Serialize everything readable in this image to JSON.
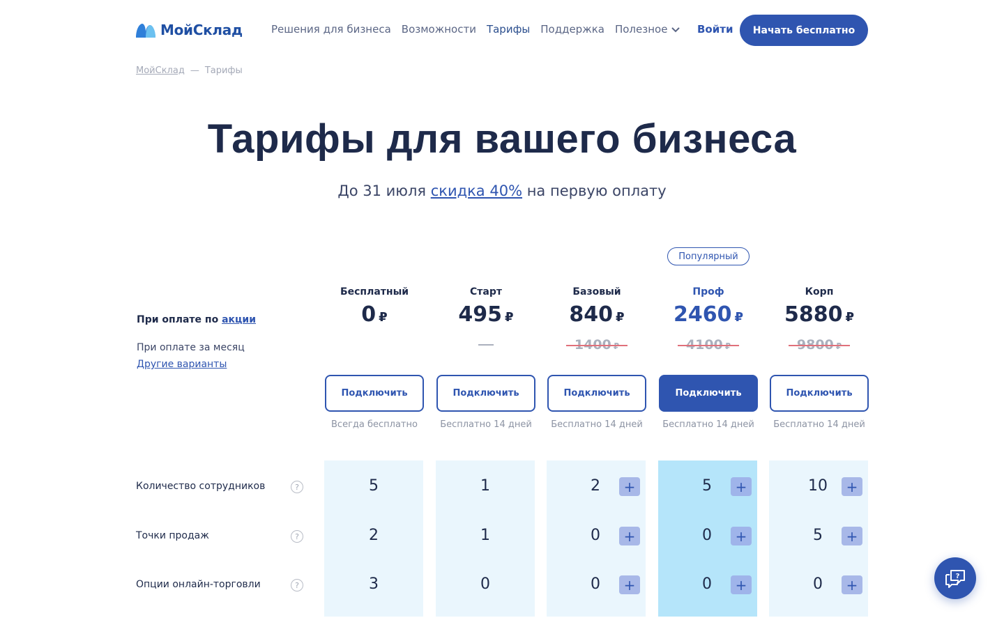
{
  "header": {
    "logo_text": "МойСклад",
    "nav": [
      "Решения для бизнеса",
      "Возможности",
      "Тарифы",
      "Поддержка",
      "Полезное"
    ],
    "login": "Войти",
    "cta": "Начать бесплатно"
  },
  "breadcrumb": {
    "home": "МойСклад",
    "sep": "—",
    "current": "Тарифы"
  },
  "hero": {
    "title": "Тарифы для вашего бизнеса",
    "sub_before": "До 31 июля ",
    "sub_link": "скидка 40%",
    "sub_after": " на первую оплату"
  },
  "labels": {
    "promo_prefix": "При оплате по ",
    "promo_link": "акции",
    "month": "При оплате за месяц",
    "other": "Другие варианты",
    "popular": "Популярный",
    "currency": "₽"
  },
  "plans": [
    {
      "name": "Бесплатный",
      "price": "0",
      "old": "",
      "dash": false,
      "button": "Подключить",
      "trial": "Всегда бесплатно"
    },
    {
      "name": "Старт",
      "price": "495",
      "old": "",
      "dash": true,
      "button": "Подключить",
      "trial": "Бесплатно 14 дней"
    },
    {
      "name": "Базовый",
      "price": "840",
      "old": "1400",
      "dash": false,
      "button": "Подключить",
      "trial": "Бесплатно 14 дней"
    },
    {
      "name": "Проф",
      "price": "2460",
      "old": "4100",
      "dash": false,
      "button": "Подключить",
      "trial": "Бесплатно 14 дней"
    },
    {
      "name": "Корп",
      "price": "5880",
      "old": "9800",
      "dash": false,
      "button": "Подключить",
      "trial": "Бесплатно 14 дней"
    }
  ],
  "features": [
    {
      "label": "Количество сотрудников",
      "values": [
        "5",
        "1",
        "2",
        "5",
        "10"
      ]
    },
    {
      "label": "Точки продаж",
      "values": [
        "2",
        "1",
        "0",
        "0",
        "5"
      ]
    },
    {
      "label": "Опции онлайн-торговли",
      "values": [
        "3",
        "0",
        "0",
        "0",
        "0"
      ]
    }
  ],
  "icons": {
    "help": "question-icon",
    "add": "plus-icon",
    "chat": "chat-help-icon",
    "dropdown": "chevron-down-icon"
  },
  "colors": {
    "brand": "#2f55b0",
    "popular_column": "#b5e5fa",
    "column": "#eaf6fd",
    "strike": "#e0707a"
  }
}
